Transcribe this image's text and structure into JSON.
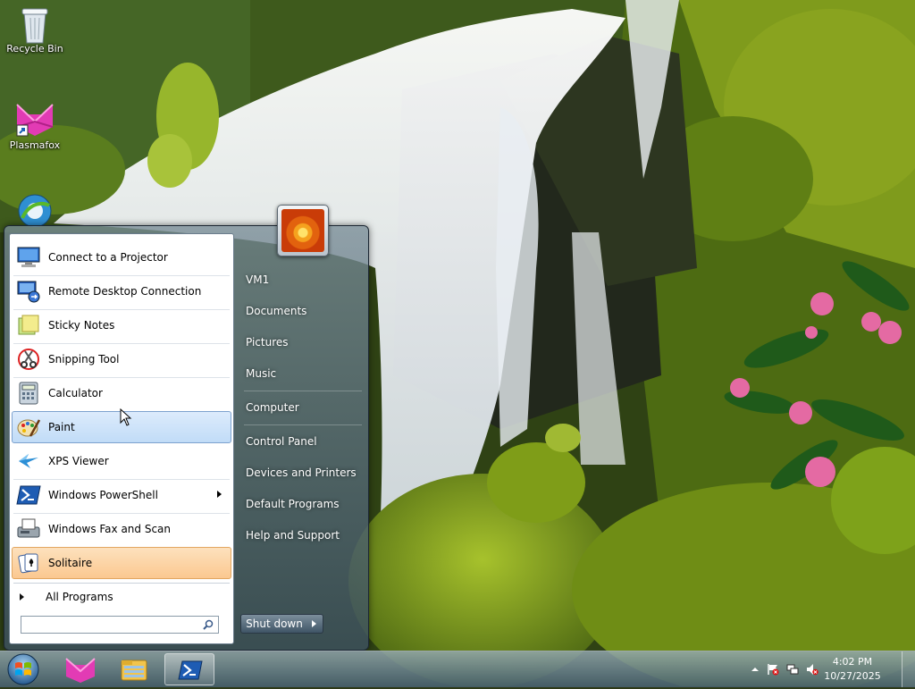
{
  "desktop": {
    "icons": [
      {
        "label": "Recycle Bin",
        "icon": "recycle-bin-icon"
      },
      {
        "label": "Plasmafox",
        "icon": "plasmafox-icon"
      },
      {
        "label": "",
        "icon": "internet-icon"
      }
    ]
  },
  "start_menu": {
    "programs": [
      {
        "label": "Connect to a Projector",
        "icon": "projector-icon",
        "state": "normal"
      },
      {
        "label": "Remote Desktop Connection",
        "icon": "remote-desktop-icon",
        "state": "normal"
      },
      {
        "label": "Sticky Notes",
        "icon": "sticky-notes-icon",
        "state": "normal"
      },
      {
        "label": "Snipping Tool",
        "icon": "snipping-tool-icon",
        "state": "normal"
      },
      {
        "label": "Calculator",
        "icon": "calculator-icon",
        "state": "normal"
      },
      {
        "label": "Paint",
        "icon": "paint-icon",
        "state": "hover"
      },
      {
        "label": "XPS Viewer",
        "icon": "xps-viewer-icon",
        "state": "normal"
      },
      {
        "label": "Windows PowerShell",
        "icon": "powershell-icon",
        "state": "normal",
        "has_submenu": true
      },
      {
        "label": "Windows Fax and Scan",
        "icon": "fax-scan-icon",
        "state": "normal"
      },
      {
        "label": "Solitaire",
        "icon": "solitaire-icon",
        "state": "highlighted"
      }
    ],
    "all_programs_label": "All Programs",
    "search_placeholder": "",
    "right_items": [
      {
        "label": "VM1"
      },
      {
        "label": "Documents"
      },
      {
        "label": "Pictures"
      },
      {
        "label": "Music"
      },
      {
        "label": "Computer"
      },
      {
        "label": "Control Panel"
      },
      {
        "label": "Devices and Printers"
      },
      {
        "label": "Default Programs"
      },
      {
        "label": "Help and Support"
      }
    ],
    "shutdown_label": "Shut down"
  },
  "taskbar": {
    "items": [
      {
        "name": "start-orb"
      },
      {
        "name": "taskbar-plasmafox",
        "icon": "plasmafox-icon"
      },
      {
        "name": "taskbar-explorer",
        "icon": "folder-icon"
      },
      {
        "name": "taskbar-powershell",
        "icon": "powershell-icon",
        "active": true
      }
    ],
    "clock": {
      "time": "4:02 PM",
      "date": "10/27/2025"
    }
  },
  "colors": {
    "hover_bg": "#c1dcf7",
    "pinned_bg": "#fbc890",
    "taskbar": "#5a7484"
  }
}
